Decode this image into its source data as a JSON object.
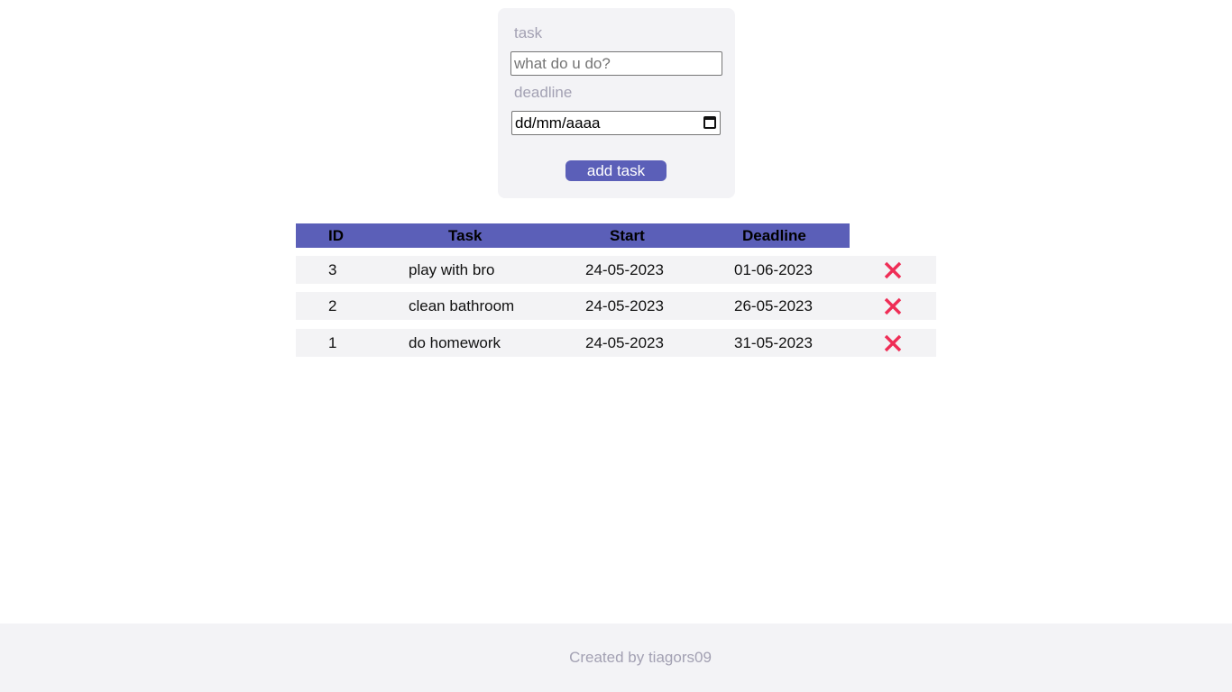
{
  "form": {
    "task_label": "task",
    "task_placeholder": "what do u do?",
    "task_value": "",
    "deadline_label": "deadline",
    "deadline_value": "dd/mm/aaaa",
    "add_button_label": "add task"
  },
  "table": {
    "headers": [
      "ID",
      "Task",
      "Start",
      "Deadline"
    ],
    "rows": [
      {
        "id": "3",
        "task": "play with bro",
        "start": "24-05-2023",
        "deadline": "01-06-2023"
      },
      {
        "id": "2",
        "task": "clean bathroom",
        "start": "24-05-2023",
        "deadline": "26-05-2023"
      },
      {
        "id": "1",
        "task": "do homework",
        "start": "24-05-2023",
        "deadline": "31-05-2023"
      }
    ],
    "delete_icon": "close-icon"
  },
  "footer": {
    "text": "Created by tiagors09"
  },
  "colors": {
    "accent": "#5b5fb8",
    "delete": "#ef2d56",
    "card_bg": "#f3f3f6",
    "muted_text": "#a3a1b3"
  }
}
